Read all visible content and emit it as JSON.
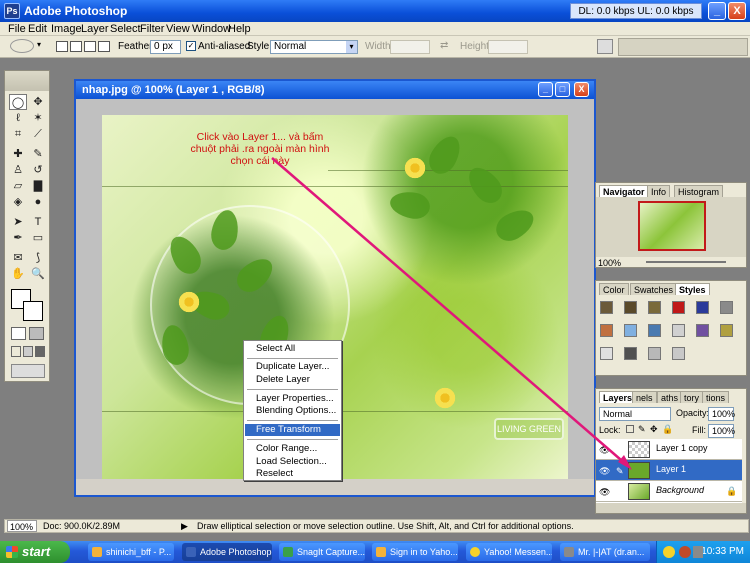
{
  "app": {
    "title": "Adobe Photoshop",
    "logo_text": "Ps",
    "net_stats": "DL: 0.0 kbps  UL: 0.0 kbps",
    "minimize": "_",
    "restore": "□",
    "close": "X"
  },
  "menu": [
    "File",
    "Edit",
    "Image",
    "Layer",
    "Select",
    "Filter",
    "View",
    "Window",
    "Help"
  ],
  "options": {
    "feather_label": "Feather:",
    "feather_value": "0 px",
    "antialiased_label": "Anti-aliased",
    "style_label": "Style:",
    "style_value": "Normal",
    "width_label": "Width:",
    "height_label": "Height:"
  },
  "document": {
    "title": "nhap.jpg @ 100% (Layer 1 , RGB/8)",
    "watermark": "LIVING GREEN"
  },
  "annotation": [
    "Click vào Layer 1... và bấm",
    "chuột phải .ra ngoài màn hình",
    "chọn cái này"
  ],
  "context_menu": [
    "Select All",
    "Duplicate Layer...",
    "Delete Layer",
    "Layer Properties...",
    "Blending Options...",
    "Free Transform",
    "Color Range...",
    "Load Selection...",
    "Reselect"
  ],
  "navigator": {
    "tabs": [
      "Navigator",
      "Info",
      "Histogram"
    ],
    "zoom": "100%"
  },
  "color_panel": {
    "tabs": [
      "Color",
      "Swatches",
      "Styles"
    ]
  },
  "layers": {
    "tabs": [
      "Layers",
      "nels",
      "aths",
      "tory",
      "tions"
    ],
    "mode": "Normal",
    "opacity_label": "Opacity:",
    "opacity": "100%",
    "lock_label": "Lock:",
    "fill_label": "Fill:",
    "fill": "100%",
    "items": [
      {
        "name": "Layer 1 copy"
      },
      {
        "name": "Layer 1"
      },
      {
        "name": "Background"
      }
    ]
  },
  "status": {
    "zoom": "100%",
    "doc": "Doc: 900.0K/2.89M",
    "hint": "Draw elliptical selection or move selection outline.  Use Shift, Alt, and Ctrl for additional options."
  },
  "taskbar": {
    "start": "start",
    "items": [
      "shinichi_bff - P...",
      "Adobe Photoshop",
      "SnagIt Capture...",
      "Sign in to Yaho...",
      "Yahoo! Messen...",
      "Mr. |-|AT (dr.an..."
    ],
    "clock": "10:33 PM"
  }
}
